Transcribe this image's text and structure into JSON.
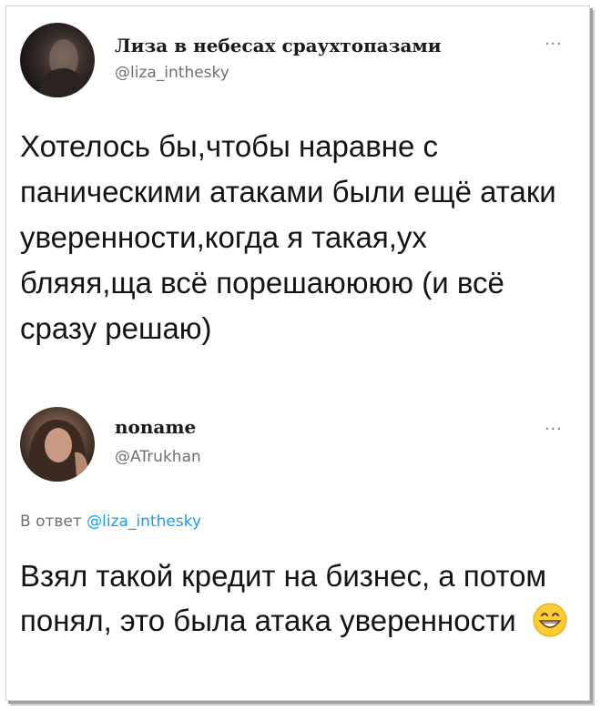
{
  "tweet1": {
    "author": "Лиза в небесах сраухтопазами",
    "handle": "@liza_inthesky",
    "more_label": "...",
    "text": "Хотелось бы,чтобы наравне с паническими атаками были ещё атаки уверенности,когда я такая,ух бляяя,ща всё порешаюююю (и всё сразу решаю)"
  },
  "tweet2": {
    "author": "noname",
    "handle": "@ATrukhan",
    "more_label": "...",
    "reply_prefix": "В ответ",
    "reply_to": "@liza_inthesky",
    "text": "Взял такой кредит на бизнес, а потом понял, это была атака уверенности",
    "emoji": "grinning-face-emoji"
  }
}
